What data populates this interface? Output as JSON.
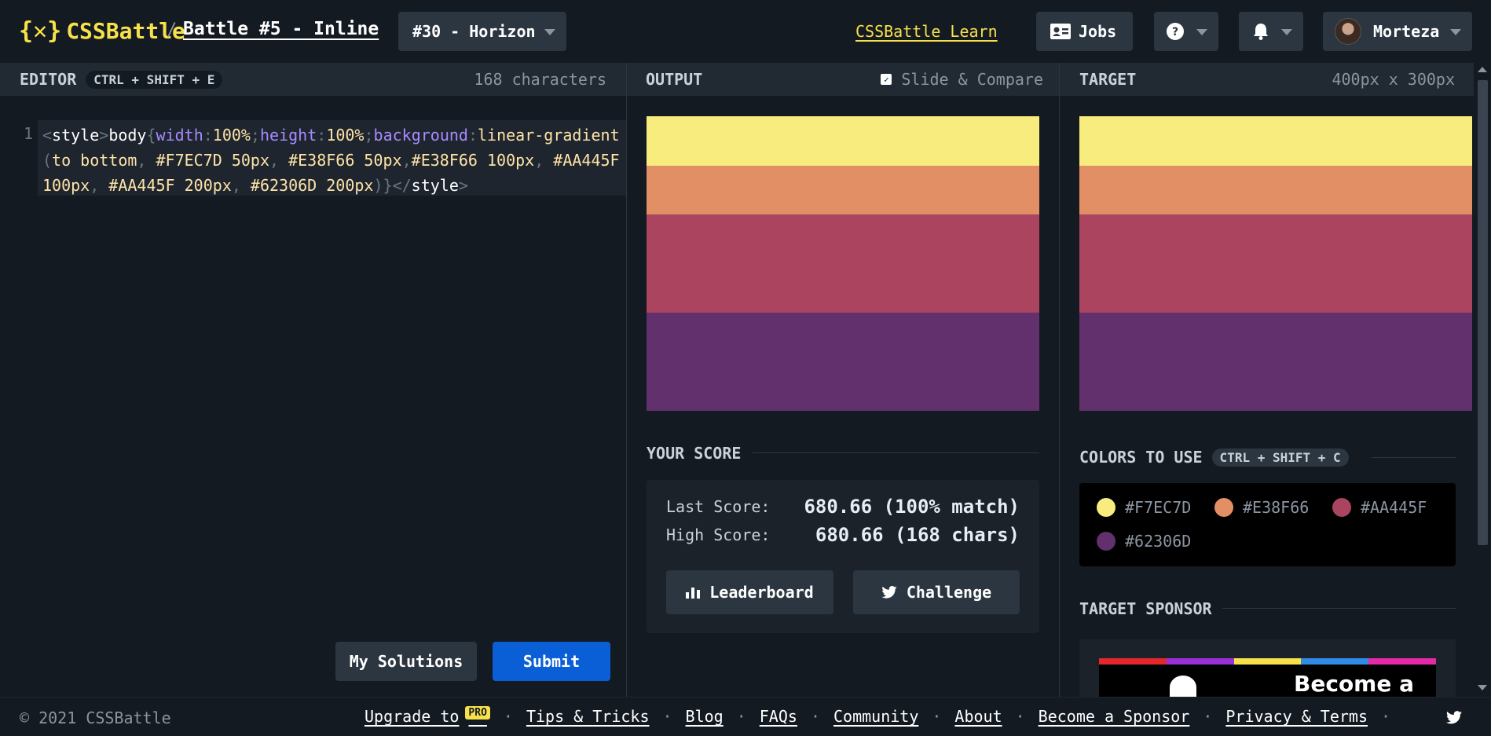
{
  "header": {
    "logo_text": "CSSBattle",
    "logo_mark": "{✕}",
    "separator": "/",
    "battle_title": "Battle #5 - Inline",
    "target_select": "#30 - Horizon",
    "learn_link": "CSSBattle Learn",
    "jobs_label": "Jobs",
    "help_icon": "question-icon",
    "bell_icon": "bell-icon",
    "user_name": "Morteza"
  },
  "editor": {
    "title": "EDITOR",
    "shortcut": "CTRL + SHIFT + E",
    "char_count": "168 characters",
    "line_number": "1",
    "my_solutions_label": "My Solutions",
    "submit_label": "Submit",
    "code": {
      "t1": "<",
      "t2": "style",
      "t3": ">",
      "t4": "body",
      "t5": "{",
      "p1": "width",
      "c1": ":",
      "v1": "100%",
      "s1": ";",
      "p2": "height",
      "c2": ":",
      "v2": "100%",
      "s2": ";",
      "p3": "background",
      "c3": ":",
      "v3": "linear-gradient",
      "o1": "(",
      "v4": "to bottom",
      "k1": ",",
      "v5": " #F7EC7D 50px",
      "k2": ",",
      "v6": " #E38F66 50px",
      "k3": ",",
      "v7": "#E38F66 100px",
      "k4": ",",
      "v8": " #AA445F 100px",
      "k5": ",",
      "v9": " #AA445F 200px",
      "k6": ",",
      "v10": " #62306D 200px",
      "o2": ")",
      "t6": "}",
      "t7": "</",
      "t8": "style",
      "t9": ">"
    }
  },
  "output": {
    "title": "OUTPUT",
    "slide_compare_label": "Slide & Compare",
    "slide_compare_checked": true,
    "stripes": [
      "#F7EC7D",
      "#E38F66",
      "#AA445F",
      "#62306D"
    ]
  },
  "target": {
    "title": "TARGET",
    "dimensions": "400px x 300px",
    "stripes": [
      "#F7EC7D",
      "#E38F66",
      "#AA445F",
      "#62306D"
    ]
  },
  "score": {
    "title": "YOUR SCORE",
    "last_label": "Last Score:",
    "last_value": "680.66 (100% match)",
    "high_label": "High Score:",
    "high_value": "680.66 (168 chars)",
    "leaderboard_label": "Leaderboard",
    "challenge_label": "Challenge"
  },
  "colors": {
    "title": "COLORS TO USE",
    "shortcut": "CTRL + SHIFT + C",
    "items": [
      {
        "hex": "#F7EC7D",
        "label": "#F7EC7D"
      },
      {
        "hex": "#E38F66",
        "label": "#E38F66"
      },
      {
        "hex": "#AA445F",
        "label": "#AA445F"
      },
      {
        "hex": "#62306D",
        "label": "#62306D"
      }
    ]
  },
  "sponsor": {
    "title": "TARGET SPONSOR",
    "banner_text": "Become a",
    "stripe_colors": [
      "#e5262a",
      "#9b30d9",
      "#f7e14b",
      "#2f8be5",
      "#e52aa8"
    ]
  },
  "footer": {
    "copyright": "© 2021 CSSBattle",
    "links": [
      "Upgrade to",
      "Tips & Tricks",
      "Blog",
      "FAQs",
      "Community",
      "About",
      "Become a Sponsor",
      "Privacy & Terms"
    ],
    "pro_badge": "PRO",
    "separator": "·",
    "twitter_icon": "twitter-icon"
  },
  "accent_colors": {
    "brand_yellow": "#F7E14B",
    "submit_blue": "#0B5FD6",
    "background": "#141A21"
  }
}
